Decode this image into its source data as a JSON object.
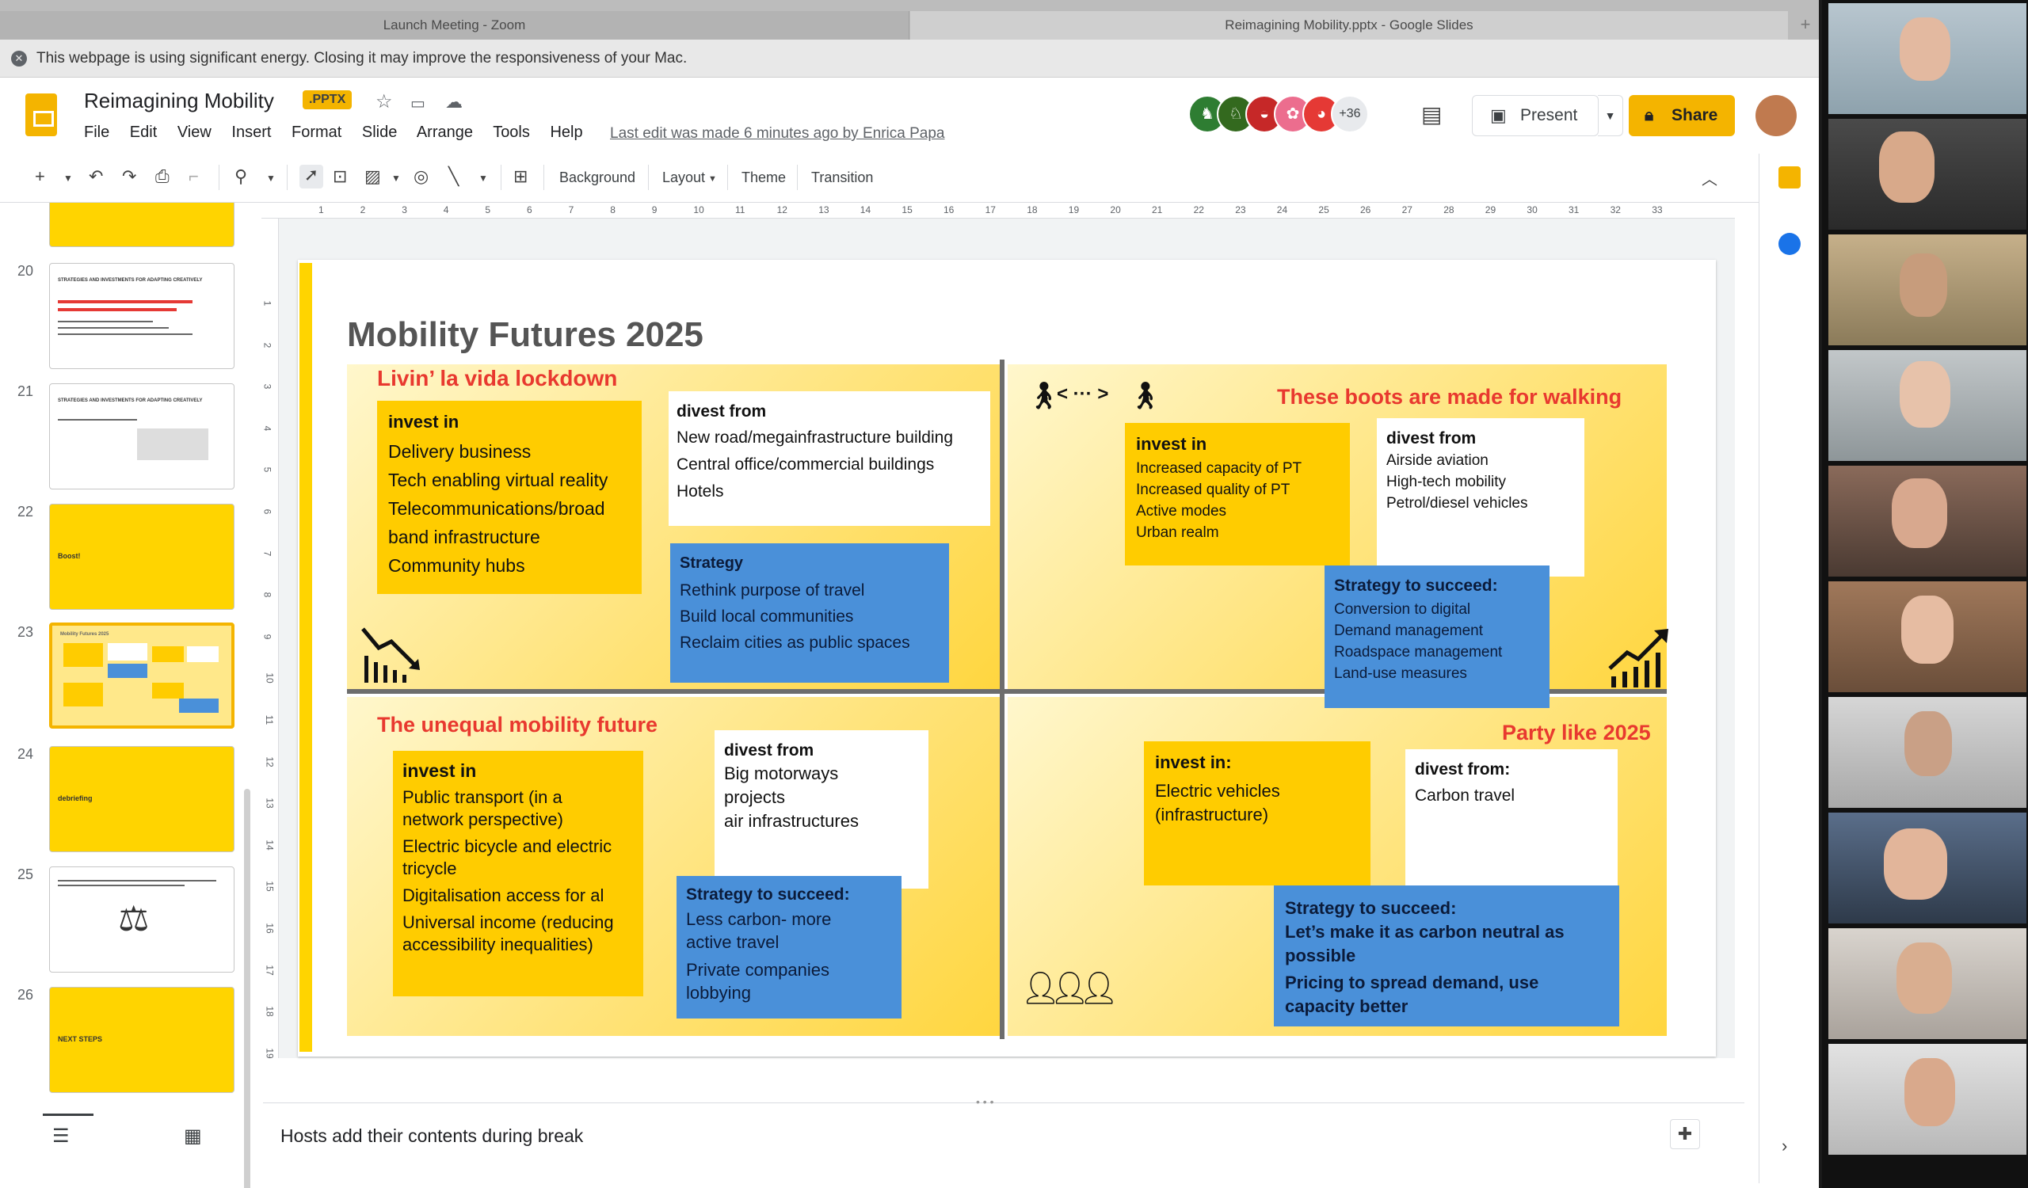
{
  "tabs": {
    "zoom": "Launch Meeting - Zoom",
    "slides": "Reimagining Mobility.pptx - Google Slides",
    "new_tab": "+"
  },
  "warning": {
    "text": "This webpage is using significant energy. Closing it may improve the responsiveness of your Mac."
  },
  "doc": {
    "title": "Reimagining Mobility",
    "badge": ".PPTX",
    "last_edit": "Last edit was made 6 minutes ago by Enrica Papa"
  },
  "menu": [
    "File",
    "Edit",
    "View",
    "Insert",
    "Format",
    "Slide",
    "Arrange",
    "Tools",
    "Help"
  ],
  "collaborators": {
    "more": "+36"
  },
  "buttons": {
    "present": "Present",
    "share": "Share"
  },
  "toolbar": {
    "background": "Background",
    "layout": "Layout",
    "theme": "Theme",
    "transition": "Transition"
  },
  "ruler": [
    "1",
    "2",
    "3",
    "4",
    "5",
    "6",
    "7",
    "8",
    "9",
    "10",
    "11",
    "12",
    "13",
    "14",
    "15",
    "16",
    "17",
    "18",
    "19",
    "20",
    "21",
    "22",
    "23",
    "24",
    "25",
    "26",
    "27",
    "28",
    "29",
    "30",
    "31",
    "32",
    "33"
  ],
  "vruler": [
    "1",
    "2",
    "3",
    "4",
    "5",
    "6",
    "7",
    "8",
    "9",
    "10",
    "11",
    "12",
    "13",
    "14",
    "15",
    "16",
    "17",
    "18",
    "19"
  ],
  "filmstrip": [
    {
      "num": "20",
      "title": "STRATEGIES AND INVESTMENTS FOR ADAPTING CREATIVELY"
    },
    {
      "num": "21",
      "title": "STRATEGIES AND INVESTMENTS FOR ADAPTING CREATIVELY"
    },
    {
      "num": "22",
      "title": "Boost!"
    },
    {
      "num": "23",
      "title": "Mobility Futures 2025"
    },
    {
      "num": "24",
      "title": "debriefing"
    },
    {
      "num": "25",
      "title": ""
    },
    {
      "num": "26",
      "title": "NEXT STEPS"
    }
  ],
  "notes": {
    "text": "Hosts add their contents during break"
  },
  "slide": {
    "title": "Mobility Futures 2025",
    "q1": {
      "title": "Livin’ la vida lockdown",
      "invest_head": "invest in",
      "invest": [
        "Delivery business",
        "Tech enabling virtual reality",
        "Telecommunications/broad",
        "band infrastructure",
        "Community hubs"
      ],
      "divest_head": "divest from",
      "divest": [
        "New road/megainfrastructure building",
        "Central office/commercial buildings",
        "Hotels"
      ],
      "strategy_head": "Strategy",
      "strategy": [
        "Rethink purpose of travel",
        "Build local communities",
        "Reclaim cities as public spaces"
      ]
    },
    "q2": {
      "title": "These boots are made for walking",
      "arrows": "< ··· >",
      "invest_head": "invest in",
      "invest": [
        "Increased capacity of PT",
        "Increased quality of PT",
        "Active modes",
        "Urban realm"
      ],
      "divest_head": "divest from",
      "divest": [
        "Airside aviation",
        "High-tech mobility",
        "Petrol/diesel vehicles"
      ],
      "strategy_head": "Strategy to succeed:",
      "strategy": [
        "Conversion to digital",
        "Demand management",
        "Roadspace management",
        "Land-use measures"
      ]
    },
    "q3": {
      "title": "The unequal mobility future",
      "invest_head": "invest in",
      "invest": [
        "Public transport (in a",
        "network perspective)",
        "Electric bicycle and electric",
        "tricycle",
        "Digitalisation access for al",
        "Universal income (reducing",
        "accessibility inequalities)"
      ],
      "divest_head": "divest from",
      "divest": [
        "Big motorways",
        "projects",
        "air infrastructures"
      ],
      "strategy_head": "Strategy to succeed:",
      "strategy": [
        "Less carbon- more",
        "active travel",
        "Private companies",
        "lobbying"
      ]
    },
    "q4": {
      "title": "Party like 2025",
      "invest_head": "invest in:",
      "invest": [
        "Electric vehicles",
        "(infrastructure)"
      ],
      "divest_head": "divest from:",
      "divest": [
        "Carbon travel"
      ],
      "strategy_head": "Strategy to succeed:",
      "strategy": [
        "Let’s make it as carbon neutral as",
        "possible",
        "Pricing to spread demand, use",
        "capacity better"
      ]
    }
  },
  "colors": {
    "brand": "#f4b400",
    "slide_yellow": "#ffcc00",
    "strategy_blue": "#4a90d9",
    "title_red": "#e8392f"
  }
}
